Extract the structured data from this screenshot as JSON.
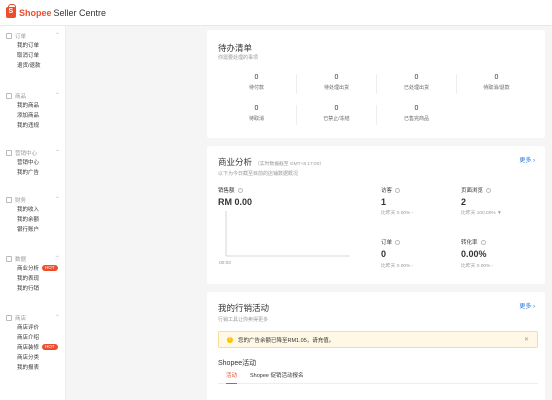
{
  "header": {
    "brand": "Shopee",
    "title": "Seller Centre"
  },
  "sidebar": {
    "sections": [
      {
        "title": "订单",
        "items": [
          {
            "label": "我的订单"
          },
          {
            "label": "取消订单"
          },
          {
            "label": "退货/退款"
          }
        ]
      },
      {
        "title": "商品",
        "items": [
          {
            "label": "我的商品"
          },
          {
            "label": "添加商品"
          },
          {
            "label": "我的违规"
          }
        ]
      },
      {
        "title": "营销中心",
        "items": [
          {
            "label": "营销中心"
          },
          {
            "label": "我的广告"
          }
        ]
      },
      {
        "title": "财务",
        "items": [
          {
            "label": "我的收入"
          },
          {
            "label": "我的余额"
          },
          {
            "label": "银行账户"
          }
        ]
      },
      {
        "title": "数据",
        "items": [
          {
            "label": "商业分析",
            "badge": "HOT"
          },
          {
            "label": "我的表现"
          },
          {
            "label": "我的行销"
          }
        ]
      },
      {
        "title": "商店",
        "items": [
          {
            "label": "商店评价"
          },
          {
            "label": "商店介绍"
          },
          {
            "label": "商店装修",
            "badge": "HOT"
          },
          {
            "label": "商店分类"
          },
          {
            "label": "我的报表"
          }
        ]
      }
    ]
  },
  "todo": {
    "title": "待办清单",
    "subtitle": "你需要处理的事项",
    "items": [
      {
        "value": "0",
        "label": "待付款"
      },
      {
        "value": "0",
        "label": "待处理出货"
      },
      {
        "value": "0",
        "label": "已处理出货"
      },
      {
        "value": "0",
        "label": "待取消/退款"
      },
      {
        "value": "0",
        "label": "待取消"
      },
      {
        "value": "0",
        "label": "已禁止/冻结"
      },
      {
        "value": "0",
        "label": "已售完商品"
      }
    ]
  },
  "analytics": {
    "title": "商业分析",
    "time_note": "（实时数据截至 GMT+8 17:00）",
    "subtitle": "以下为今日截至目前的店铺数据概况",
    "more": "更多",
    "sales": {
      "label": "销售额",
      "value": "RM 0.00",
      "axis_label": "00:00"
    },
    "metrics": [
      {
        "label": "访客",
        "value": "1",
        "cmp": "比昨天 0.00% -"
      },
      {
        "label": "页面浏览",
        "value": "2",
        "cmp": "比昨天 100.00% ▼"
      },
      {
        "label": "订单",
        "value": "0",
        "cmp": "比昨天 0.00% -"
      },
      {
        "label": "转化率",
        "value": "0.00%",
        "cmp": "比昨天 0.00% -"
      }
    ]
  },
  "campaigns": {
    "title": "我的行销活动",
    "subtitle": "行销工具让你卖得更多",
    "more": "更多",
    "banner": "您的广告余额已降至RM1.05，请充值。",
    "section_title": "Shopee活动",
    "tabs": [
      {
        "label": "活动"
      },
      {
        "label": "Shopee 促销活动报名"
      }
    ]
  },
  "colors": {
    "accent": "#ee4d2d",
    "link": "#2673dd",
    "warning": "#ffbf00"
  }
}
